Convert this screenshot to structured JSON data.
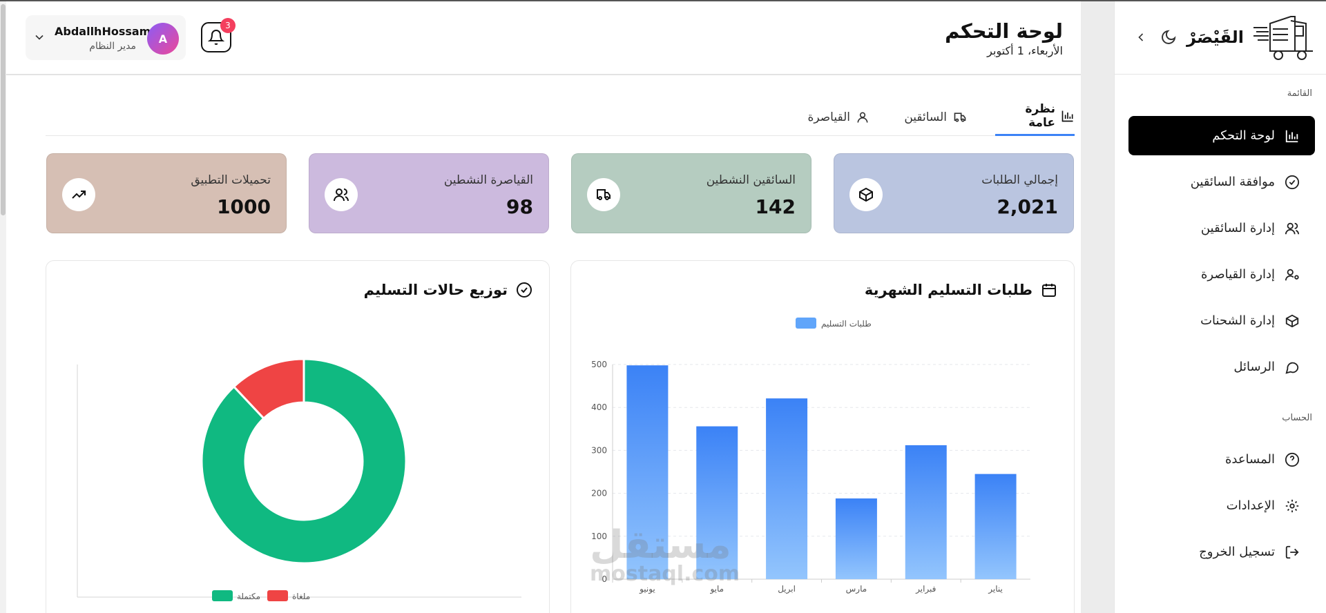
{
  "header": {
    "title": "لوحة التحكم",
    "date": "الأربعاء، 1 أكتوبر",
    "user_name": "AbdallhHossam",
    "user_role": "مدير النظام",
    "avatar_letter": "A",
    "notification_count": "3"
  },
  "tabs": [
    {
      "label": "نظرة عامة",
      "icon": "bar-chart-icon",
      "active": true
    },
    {
      "label": "السائقين",
      "icon": "truck-icon",
      "active": false
    },
    {
      "label": "القياصرة",
      "icon": "user-icon",
      "active": false
    }
  ],
  "stats": [
    {
      "label": "إجمالي الطلبات",
      "value": "2,021",
      "icon": "package-icon",
      "color": "#bac5e0"
    },
    {
      "label": "السائقين النشطين",
      "value": "142",
      "icon": "truck-icon",
      "color": "#b5ccc0"
    },
    {
      "label": "القياصرة النشطين",
      "value": "98",
      "icon": "users-icon",
      "color": "#ccbade"
    },
    {
      "label": "تحميلات التطبيق",
      "value": "1000",
      "icon": "trending-up-icon",
      "color": "#d6bfb4"
    }
  ],
  "monthly_panel": {
    "title": "طلبات التسليم الشهرية",
    "icon": "calendar-icon"
  },
  "status_panel": {
    "title": "توزيع حالات التسليم",
    "icon": "check-circle-icon"
  },
  "chart_data": [
    {
      "type": "bar",
      "title": "طلبات التسليم الشهرية",
      "categories": [
        "يناير",
        "فبراير",
        "مارس",
        "ابريل",
        "مايو",
        "يونيو"
      ],
      "series": [
        {
          "name": "طلبات التسليم",
          "values": [
            245,
            312,
            188,
            421,
            356,
            498
          ],
          "color": "#3b82f6"
        }
      ],
      "yticks": [
        0,
        100,
        200,
        300,
        400,
        500
      ],
      "ylim": [
        0,
        500
      ],
      "grid": true,
      "legend": "top-center"
    },
    {
      "type": "pie",
      "title": "توزيع حالات التسليم",
      "labels": [
        "مكتملة",
        "ملغاة"
      ],
      "values": [
        88,
        12
      ],
      "colors": [
        "#10b981",
        "#ef4444"
      ],
      "legend": "bottom"
    }
  ],
  "sidebar": {
    "brand": "القَيْصَرْ",
    "section_menu": "القائمة",
    "section_account": "الحساب",
    "menu": [
      {
        "label": "لوحة التحكم",
        "icon": "bar-chart-icon",
        "active": true
      },
      {
        "label": "موافقة السائقين",
        "icon": "check-circle-icon",
        "active": false
      },
      {
        "label": "إدارة السائقين",
        "icon": "users-icon",
        "active": false
      },
      {
        "label": "إدارة القياصرة",
        "icon": "user-cog-icon",
        "active": false
      },
      {
        "label": "إدارة الشحنات",
        "icon": "package-icon",
        "active": false
      },
      {
        "label": "الرسائل",
        "icon": "message-icon",
        "active": false
      }
    ],
    "account": [
      {
        "label": "المساعدة",
        "icon": "help-icon"
      },
      {
        "label": "الإعدادات",
        "icon": "gear-icon"
      },
      {
        "label": "تسجيل الخروج",
        "icon": "logout-icon"
      }
    ]
  },
  "watermark": {
    "line1": "مستقل",
    "line2": "mostaql.com"
  }
}
